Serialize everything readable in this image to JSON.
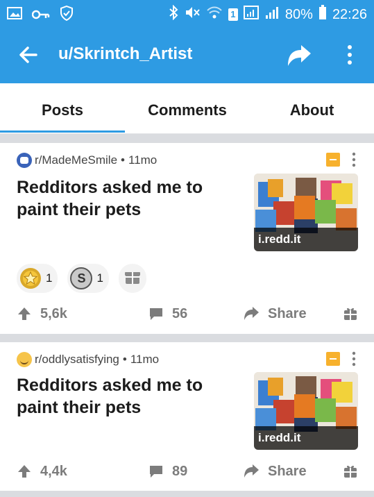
{
  "status_bar": {
    "battery": "80%",
    "time": "22:26",
    "sim_badge": "1"
  },
  "app_bar": {
    "title": "u/Skrintch_Artist"
  },
  "tabs": [
    {
      "label": "Posts",
      "selected": true
    },
    {
      "label": "Comments",
      "selected": false
    },
    {
      "label": "About",
      "selected": false
    }
  ],
  "colors": {
    "accent": "#2e9be3",
    "archive": "#f7b12d",
    "meta": "#7c7c7c"
  },
  "posts": [
    {
      "subreddit": "r/MadeMeSmile",
      "age": "11mo",
      "title": "Redditors asked me to paint their pets",
      "domain": "i.redd.it",
      "awards": [
        {
          "icon": "gold-award-icon",
          "count": "1"
        },
        {
          "icon": "silver-award-icon",
          "count": "1"
        }
      ],
      "upvotes": "5,6k",
      "comments": "56",
      "share_label": "Share"
    },
    {
      "subreddit": "r/oddlysatisfying",
      "age": "11mo",
      "title": "Redditors asked me to paint their pets",
      "domain": "i.redd.it",
      "upvotes": "4,4k",
      "comments": "89",
      "share_label": "Share"
    }
  ]
}
